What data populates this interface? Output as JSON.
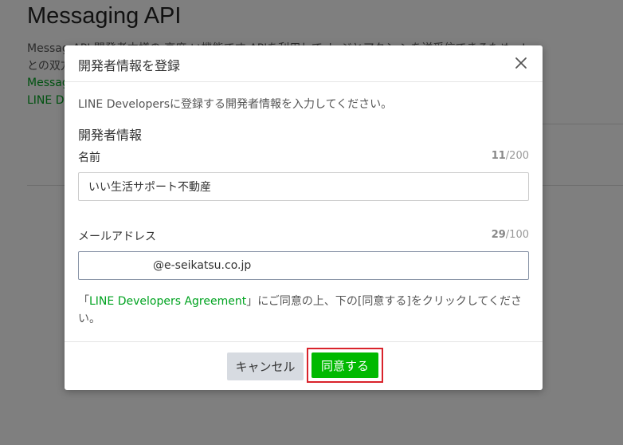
{
  "background": {
    "title": "Messaging API",
    "description_line1": "Messag  API  開発者本様の 高度 い機能です  APIを利用して ト    ジとアクシ ンを送受信できるため、L",
    "description_line2": "との双方",
    "link1": "Messag",
    "link2": "LINE De"
  },
  "modal": {
    "title": "開発者情報を登録",
    "intro": "LINE Developersに登録する開発者情報を入力してください。",
    "section_title": "開発者情報",
    "name_field": {
      "label": "名前",
      "count": "11",
      "max": "/200",
      "value": "いい生活サポート不動産"
    },
    "email_field": {
      "label": "メールアドレス",
      "count": "29",
      "max": "/100",
      "value": "@e-seikatsu.co.jp"
    },
    "agreement": {
      "prefix": "「",
      "link": "LINE Developers Agreement",
      "suffix": "」にご同意の上、下の[同意する]をクリックしてください。"
    },
    "buttons": {
      "cancel": "キャンセル",
      "agree": "同意する"
    }
  },
  "colors": {
    "accent": "#00b900",
    "link": "#00a320",
    "highlight": "#d9232b"
  }
}
